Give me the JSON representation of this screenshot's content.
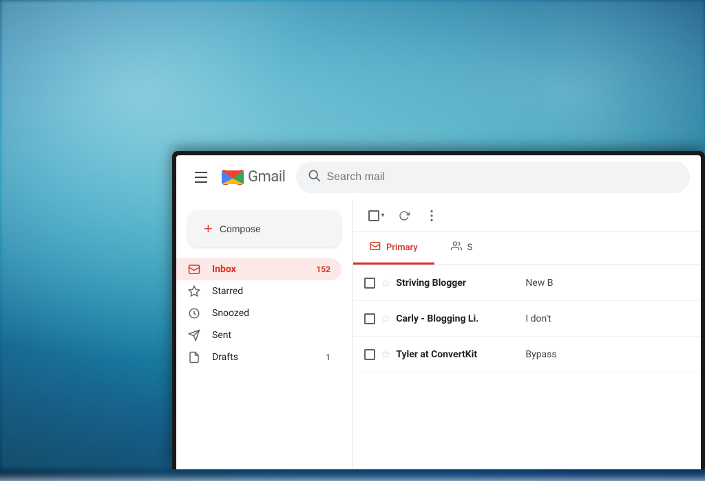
{
  "background": {
    "type": "ocean_blur",
    "colors": [
      "#7ecfd8",
      "#4aa8b8",
      "#2a7a90",
      "#1a5570",
      "#0d3a50"
    ]
  },
  "gmail": {
    "header": {
      "menu_label": "Menu",
      "logo_text": "Gmail",
      "search_placeholder": "Search mail"
    },
    "sidebar": {
      "compose_label": "Compose",
      "nav_items": [
        {
          "id": "inbox",
          "label": "Inbox",
          "badge": "152",
          "icon": "inbox",
          "active": true
        },
        {
          "id": "starred",
          "label": "Starred",
          "badge": "",
          "icon": "star",
          "active": false
        },
        {
          "id": "snoozed",
          "label": "Snoozed",
          "badge": "",
          "icon": "clock",
          "active": false
        },
        {
          "id": "sent",
          "label": "Sent",
          "badge": "",
          "icon": "send",
          "active": false
        },
        {
          "id": "drafts",
          "label": "Drafts",
          "badge": "1",
          "icon": "draft",
          "active": false
        }
      ]
    },
    "toolbar": {
      "select_all": "Select all",
      "refresh": "Refresh",
      "more": "More"
    },
    "tabs": [
      {
        "id": "primary",
        "label": "Primary",
        "active": true
      },
      {
        "id": "social",
        "label": "S",
        "active": false
      }
    ],
    "emails": [
      {
        "id": 1,
        "sender": "Striving Blogger",
        "subject": "New B",
        "preview": "",
        "starred": false,
        "read": false
      },
      {
        "id": 2,
        "sender": "Carly - Blogging Li.",
        "subject": "I don't",
        "preview": "",
        "starred": false,
        "read": false
      },
      {
        "id": 3,
        "sender": "Tyler at ConvertKit",
        "subject": "Bypass",
        "preview": "",
        "starred": false,
        "read": false
      }
    ]
  }
}
